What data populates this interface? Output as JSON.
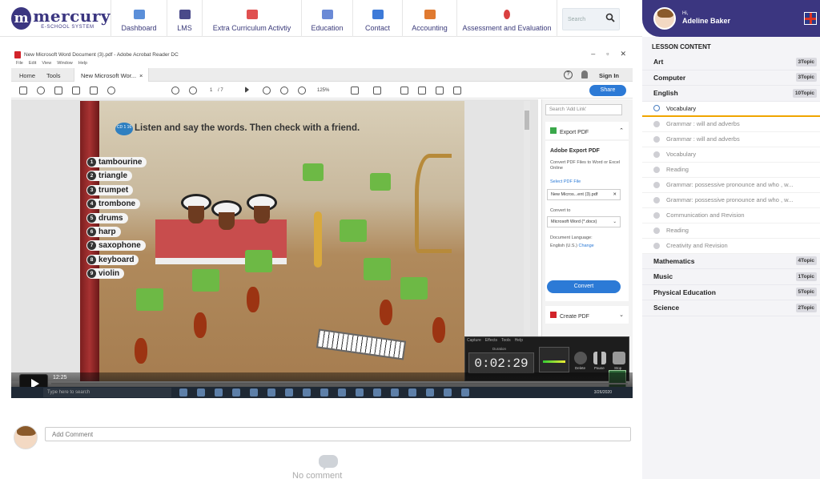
{
  "logo": {
    "name": "mercury",
    "tagline": "E-SCHOOL SYSTEM"
  },
  "nav": [
    {
      "label": "Dashboard",
      "icon": "dashboard-icon",
      "color": "#5b8fd9"
    },
    {
      "label": "LMS",
      "icon": "lms-icon",
      "color": "#4a4a8a"
    },
    {
      "label": "Extra Curriculum Activtiy",
      "icon": "extra-curriculum-icon",
      "color": "#e05050"
    },
    {
      "label": "Education",
      "icon": "education-icon",
      "color": "#6a8ad6"
    },
    {
      "label": "Contact",
      "icon": "contact-icon",
      "color": "#3d7ad8"
    },
    {
      "label": "Accounting",
      "icon": "accounting-icon",
      "color": "#e07a30"
    },
    {
      "label": "Assessment and Evaluation",
      "icon": "assessment-icon",
      "color": "#d94040"
    }
  ],
  "search": {
    "placeholder": "Search"
  },
  "user": {
    "greeting": "Hi,",
    "name": "Adeline Baker"
  },
  "sidebar": {
    "header": "LESSON CONTENT",
    "subjects_top": [
      {
        "label": "Art",
        "badge": "3Topic"
      },
      {
        "label": "Computer",
        "badge": "3Topic"
      },
      {
        "label": "English",
        "badge": "10Topic"
      }
    ],
    "english_topics": [
      "Vocabulary",
      "Grammar : will and adverbs",
      "Grammar : will and adverbs",
      "Vocabulary",
      "Reading",
      "Grammar: possessive pronounce and who , w...",
      "Grammar: possessive pronounce and who , w...",
      "Communication and Revision",
      "Reading",
      "Creativity and Revision"
    ],
    "subjects_bottom": [
      {
        "label": "Mathematics",
        "badge": "4Topic"
      },
      {
        "label": "Music",
        "badge": "1Topic"
      },
      {
        "label": "Physical Education",
        "badge": "5Topic"
      },
      {
        "label": "Science",
        "badge": "2Topic"
      }
    ]
  },
  "acrobat": {
    "title": "New Microsoft Word Document (3).pdf - Adobe Acrobat Reader DC",
    "menu": [
      "File",
      "Edit",
      "View",
      "Window",
      "Help"
    ],
    "tab_home": "Home",
    "tab_tools": "Tools",
    "tab_doc": "New Microsoft Wor...",
    "sign_in": "Sign In",
    "share": "Share",
    "page_current": "1",
    "page_total": "/ 7",
    "zoom": "125%",
    "page": {
      "cd": "CD 1 16",
      "heading": "Listen and say the words. Then check with a friend.",
      "words": [
        {
          "num": "1",
          "word": "tambourine"
        },
        {
          "num": "2",
          "word": "triangle"
        },
        {
          "num": "3",
          "word": "trumpet"
        },
        {
          "num": "4",
          "word": "trombone"
        },
        {
          "num": "5",
          "word": "drums"
        },
        {
          "num": "6",
          "word": "harp"
        },
        {
          "num": "7",
          "word": "saxophone"
        },
        {
          "num": "8",
          "word": "keyboard"
        },
        {
          "num": "9",
          "word": "violin"
        }
      ]
    },
    "right_pane": {
      "search_placeholder": "Search 'Add Link'",
      "export_pdf": "Export PDF",
      "adobe_export": "Adobe Export PDF",
      "desc": "Convert PDF Files to Word or Excel Online",
      "select_label": "Select PDF File",
      "file_name": "New Micros...ent (3).pdf",
      "convert_to_label": "Convert to",
      "convert_to_value": "Microsoft Word (*.docx)",
      "doc_lang_label": "Document Language:",
      "doc_lang_value": "English (U.S.)",
      "change": "Change",
      "convert_btn": "Convert",
      "create_pdf": "Create PDF"
    }
  },
  "recorder": {
    "menu": [
      "Capture",
      "Effects",
      "Tools",
      "Help"
    ],
    "duration_label": "Duration",
    "time": "0:02:29",
    "audio_label": "Audio",
    "delete": "Delete",
    "pause": "Pause",
    "stop": "Stop"
  },
  "video": {
    "time": "12:25"
  },
  "taskbar": {
    "search": "Type here to search",
    "date": "3/26/2020"
  },
  "comments": {
    "placeholder": "Add Comment",
    "empty": "No comment"
  }
}
